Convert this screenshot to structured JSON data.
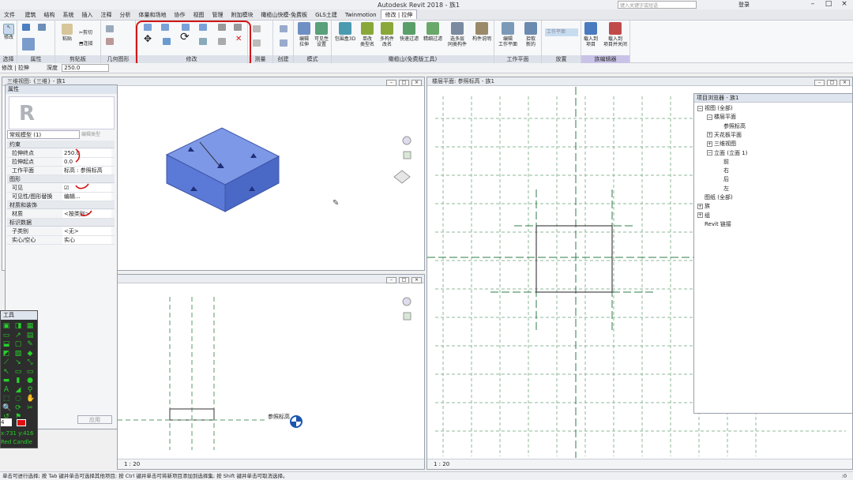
{
  "app": {
    "title": "Autodesk Revit 2018 -   族1",
    "search_placeholder": "键入关键字或短语",
    "login": "登录"
  },
  "tabs": [
    "建筑",
    "结构",
    "系统",
    "插入",
    "注释",
    "分析",
    "体量和场地",
    "协作",
    "视图",
    "管理",
    "附加模块",
    "橄榄山快模-免费板",
    "GLS土建",
    "Twinmotion",
    "修改 | 拉伸"
  ],
  "file_label": "文件",
  "ribbon": {
    "modify_label": "修改",
    "group_labels": {
      "select": "选择",
      "properties": "属性",
      "clipboard": "剪贴板",
      "geometry": "几何图形",
      "modify": "修改",
      "measure": "测量",
      "create": "创建",
      "mode": "模式",
      "gls": "橄榄山(免费版工具)",
      "workplane": "工作平面",
      "place": "放置",
      "family_editor": "族编辑器"
    },
    "clipboard": {
      "paste": "粘贴",
      "cut": "剪切",
      "join": "连接"
    },
    "buttons": [
      {
        "label": "编辑\n拉伸"
      },
      {
        "label": "可见性\n设置"
      },
      {
        "label": "包围盒3D"
      },
      {
        "label": "单改\n类型名"
      },
      {
        "label": "多构件\n改名"
      },
      {
        "label": "快速过滤"
      },
      {
        "label": "精细过滤"
      },
      {
        "label": "选多层\n同类构件"
      },
      {
        "label": "构件说明"
      },
      {
        "label": "编辑\n工作平面"
      },
      {
        "label": "拾取\n新的"
      },
      {
        "label": "载入到\n项目"
      },
      {
        "label": "载入到\n项目并关闭"
      }
    ],
    "workplane_disabled": "工作平面"
  },
  "options_bar": {
    "context": "修改 | 拉伸",
    "depth_label": "深度",
    "depth_value": "250.0"
  },
  "views": {
    "v3d": {
      "title": "三维视图: {三维} - 族1"
    },
    "plan": {
      "title": "楼层平面: 参照标高 - 族1",
      "scale": "1 : 20"
    },
    "elev": {
      "scale": "1 : 20",
      "level_label": "参照标高"
    }
  },
  "properties": {
    "title": "属性",
    "type_name": "常规模型 (1)",
    "edit_type": "编辑类型",
    "sections": [
      {
        "name": "约束",
        "rows": [
          {
            "k": "拉伸终点",
            "v": "250.0"
          },
          {
            "k": "拉伸起点",
            "v": "0.0"
          },
          {
            "k": "工作平面",
            "v": "标高 : 参照标高"
          }
        ]
      },
      {
        "name": "图形",
        "rows": [
          {
            "k": "可见",
            "v": "☑"
          },
          {
            "k": "可见性/图形替换",
            "v": "编辑..."
          }
        ]
      },
      {
        "name": "材质和装饰",
        "rows": [
          {
            "k": "材质",
            "v": "<按类别>"
          }
        ]
      },
      {
        "name": "标识数据",
        "rows": [
          {
            "k": "子类别",
            "v": "<无>"
          },
          {
            "k": "实心/空心",
            "v": "实心"
          }
        ]
      }
    ],
    "apply": "应用"
  },
  "palette": {
    "title": "工具",
    "coord_x": "x:731",
    "coord_y": "y:416",
    "name": "Red Candle",
    "size": "4"
  },
  "browser": {
    "title": "项目浏览器 - 族1",
    "nodes": [
      {
        "label": "视图 (全部)",
        "level": 0,
        "exp": "−"
      },
      {
        "label": "楼层平面",
        "level": 1,
        "exp": "−"
      },
      {
        "label": "参照标高",
        "level": 2,
        "exp": ""
      },
      {
        "label": "天花板平面",
        "level": 1,
        "exp": "+"
      },
      {
        "label": "三维视图",
        "level": 1,
        "exp": "+"
      },
      {
        "label": "立面 (立面 1)",
        "level": 1,
        "exp": "−"
      },
      {
        "label": "前",
        "level": 2,
        "exp": ""
      },
      {
        "label": "右",
        "level": 2,
        "exp": ""
      },
      {
        "label": "后",
        "level": 2,
        "exp": ""
      },
      {
        "label": "左",
        "level": 2,
        "exp": ""
      },
      {
        "label": "图纸 (全部)",
        "level": 0,
        "exp": ""
      },
      {
        "label": "族",
        "level": 0,
        "exp": "+"
      },
      {
        "label": "组",
        "level": 0,
        "exp": "+"
      },
      {
        "label": "Revit 链接",
        "level": 0,
        "exp": ""
      }
    ]
  },
  "status": "单击可进行选择; 按 Tab 键并单击可选择其他项目; 按 Ctrl 键并单击可将新项目添加到选择集; 按 Shift 键并单击可取消选择。",
  "status_right": ":0",
  "colors": {
    "accent": "#d21717",
    "box": "#5b79d6",
    "grid": "#5a9a6a"
  }
}
